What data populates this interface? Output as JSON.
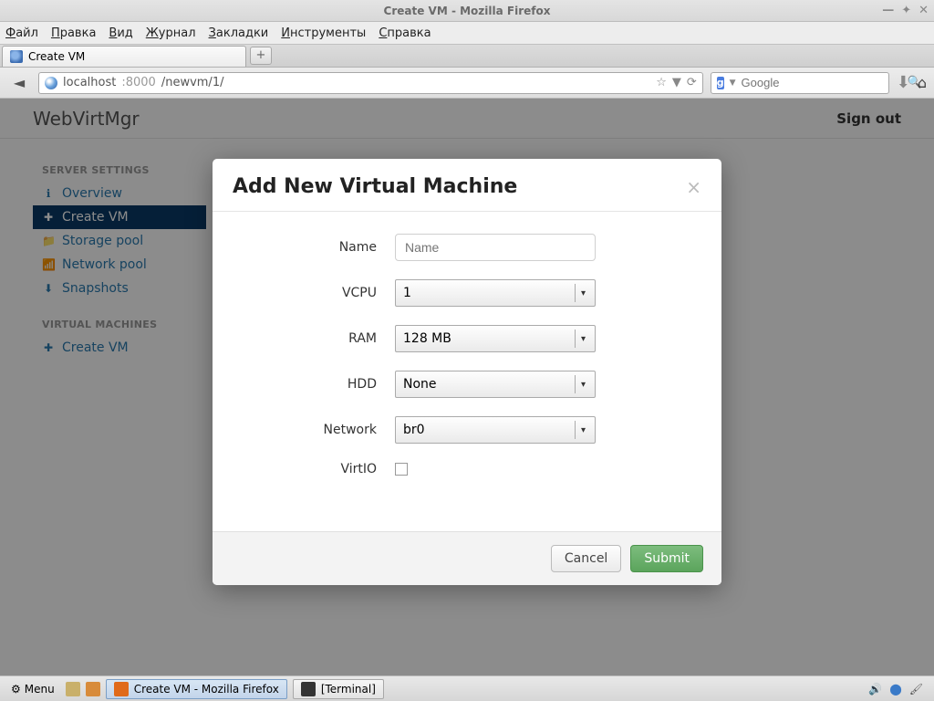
{
  "window": {
    "title": "Create VM - Mozilla Firefox"
  },
  "menubar": {
    "file": "Файл",
    "edit": "Правка",
    "view": "Вид",
    "history": "Журнал",
    "bookmarks": "Закладки",
    "tools": "Инструменты",
    "help": "Справка"
  },
  "tab": {
    "title": "Create VM"
  },
  "url": {
    "host": "localhost",
    "port": ":8000",
    "path": "/newvm/1/"
  },
  "search": {
    "placeholder": "Google"
  },
  "page": {
    "brand": "WebVirtMgr",
    "signout": "Sign out",
    "server_settings_hdr": "SERVER SETTINGS",
    "vm_hdr": "VIRTUAL MACHINES",
    "sidebar": {
      "overview": "Overview",
      "create_vm": "Create VM",
      "storage": "Storage pool",
      "network": "Network pool",
      "snapshots": "Snapshots",
      "create_vm2": "Create VM"
    }
  },
  "modal": {
    "title": "Add New Virtual Machine",
    "labels": {
      "name": "Name",
      "vcpu": "VCPU",
      "ram": "RAM",
      "hdd": "HDD",
      "network": "Network",
      "virtio": "VirtIO"
    },
    "placeholders": {
      "name": "Name"
    },
    "values": {
      "vcpu": "1",
      "ram": "128 MB",
      "hdd": "None",
      "network": "br0"
    },
    "buttons": {
      "cancel": "Cancel",
      "submit": "Submit"
    }
  },
  "taskbar": {
    "menu": "Menu",
    "task_firefox": "Create VM - Mozilla Firefox",
    "task_terminal": "[Terminal]"
  }
}
